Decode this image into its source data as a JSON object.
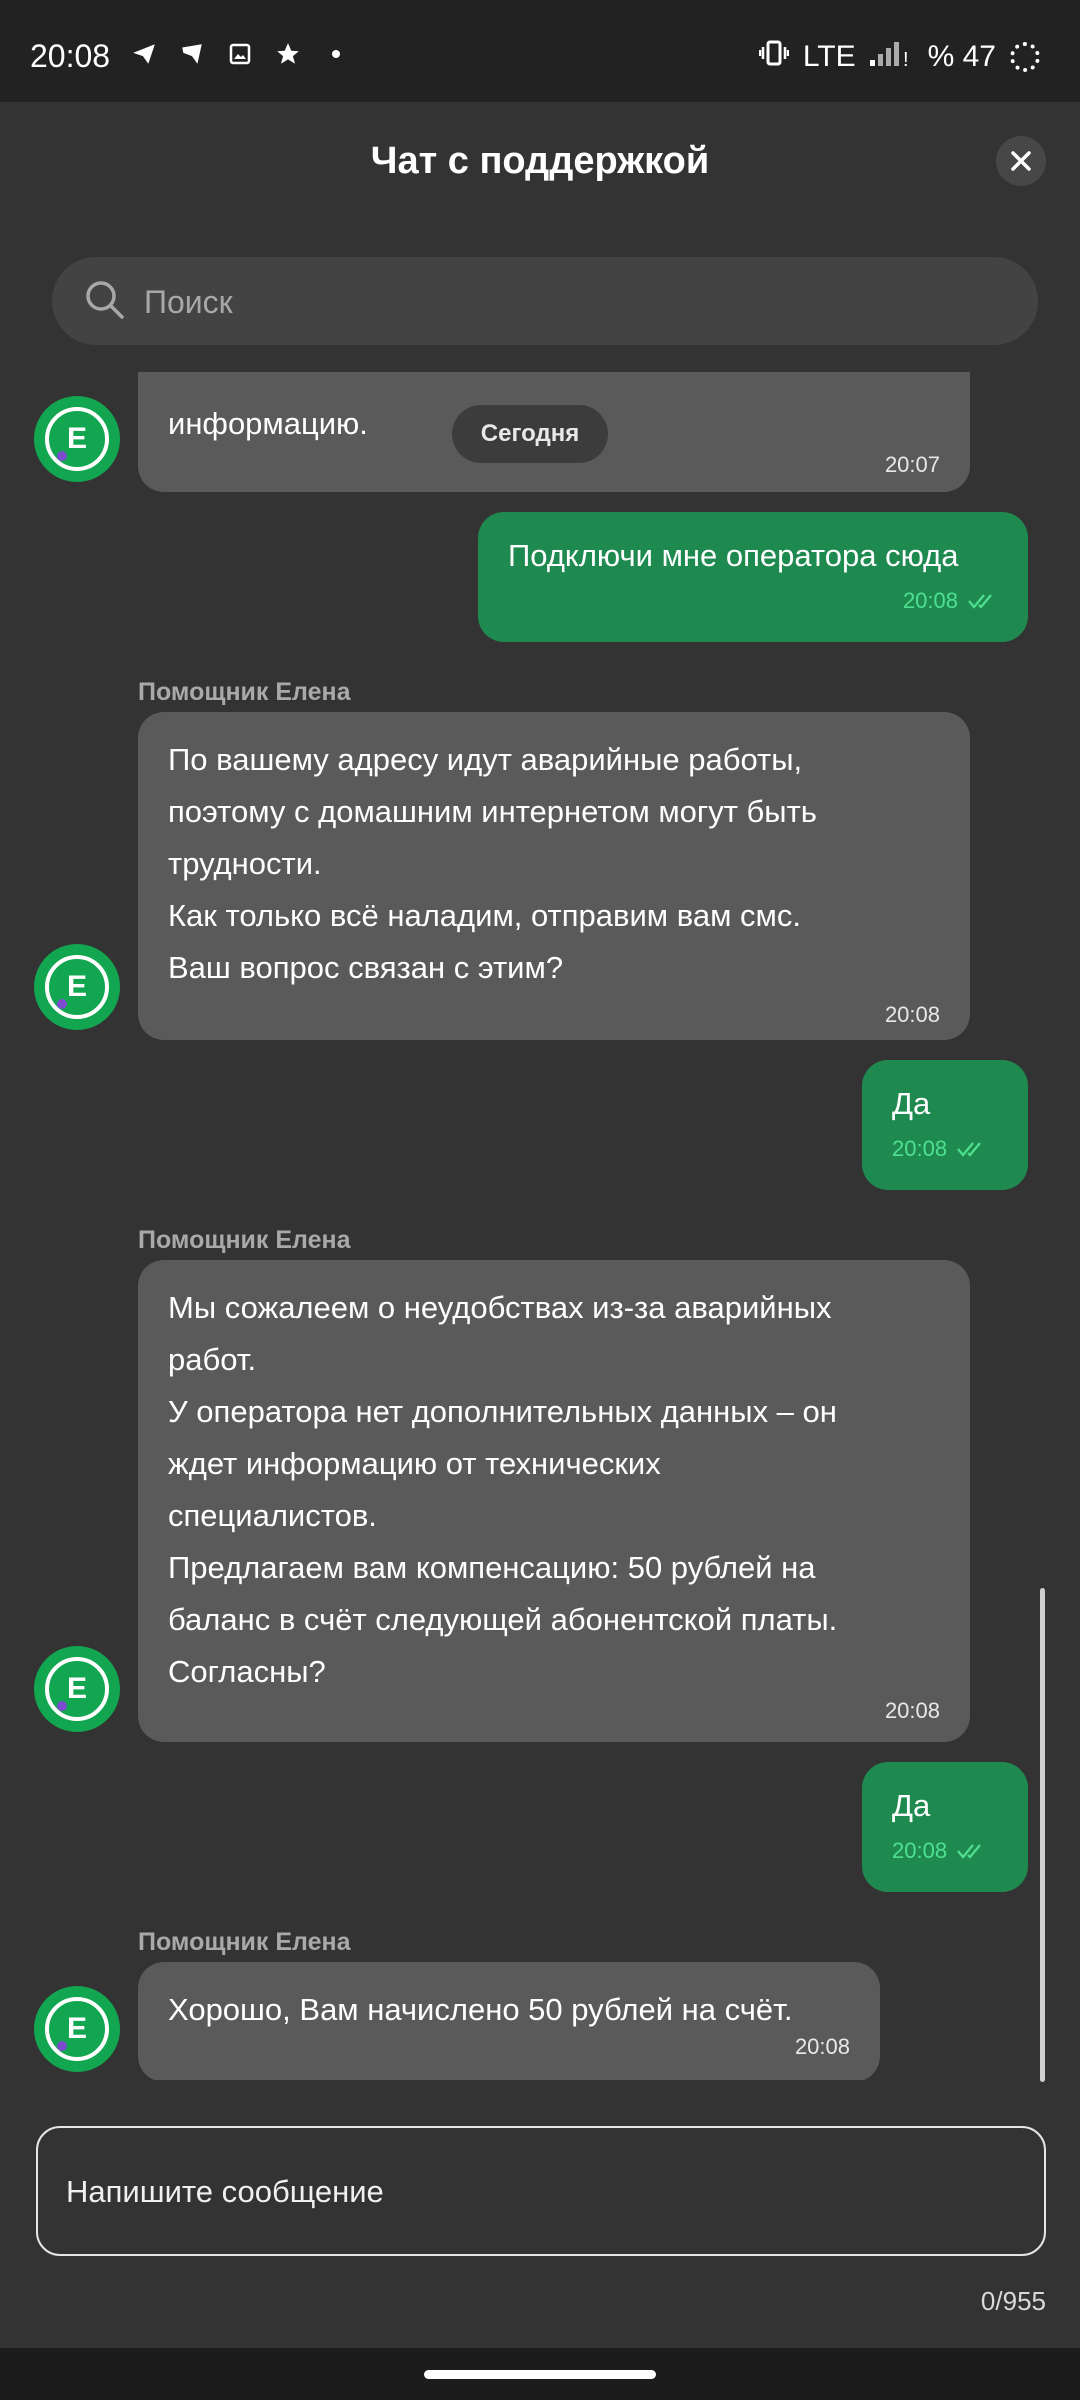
{
  "status_bar": {
    "time": "20:08",
    "network": "LTE",
    "battery": "% 47",
    "icons": [
      "telegram-icon",
      "vpn-icon",
      "gallery-icon",
      "star-icon",
      "dot-icon",
      "vibrate-icon",
      "signal-icon"
    ]
  },
  "header": {
    "title": "Чат с поддержкой"
  },
  "search": {
    "placeholder": "Поиск"
  },
  "date_separator": "Сегодня",
  "messages": [
    {
      "from": "bot",
      "lines": [
        "информацию."
      ],
      "time": "20:07"
    },
    {
      "from": "user",
      "text": "Подключи мне оператора сюда",
      "time": "20:08"
    },
    {
      "from": "bot",
      "sender": "Помощник Елена",
      "lines": [
        "По вашему адресу идут аварийные работы,",
        "поэтому с домашним интернетом могут быть",
        "трудности.",
        "Как только всё наладим, отправим вам смс.",
        "Ваш вопрос связан с этим?"
      ],
      "time": "20:08"
    },
    {
      "from": "user",
      "text": "Да",
      "time": "20:08"
    },
    {
      "from": "bot",
      "sender": "Помощник Елена",
      "lines": [
        "Мы сожалеем о неудобствах из-за аварийных",
        "работ.",
        "У оператора нет дополнительных данных – он",
        "ждет информацию от технических",
        "специалистов.",
        "Предлагаем вам компенсацию: 50 рублей на",
        "баланс в счёт следующей абонентской платы.",
        "Согласны?"
      ],
      "time": "20:08"
    },
    {
      "from": "user",
      "text": "Да",
      "time": "20:08"
    },
    {
      "from": "bot",
      "sender": "Помощник Елена",
      "lines": [
        "Хорошо, Вам начислено 50 рублей на счёт."
      ],
      "time": "20:08"
    }
  ],
  "avatar_letter": "E",
  "compose": {
    "placeholder": "Напишите сообщение",
    "counter": "0/955"
  },
  "colors": {
    "background": "#333333",
    "bot_bubble": "#5a5a5a",
    "user_bubble": "#1f8a50",
    "accent": "#12a650"
  }
}
